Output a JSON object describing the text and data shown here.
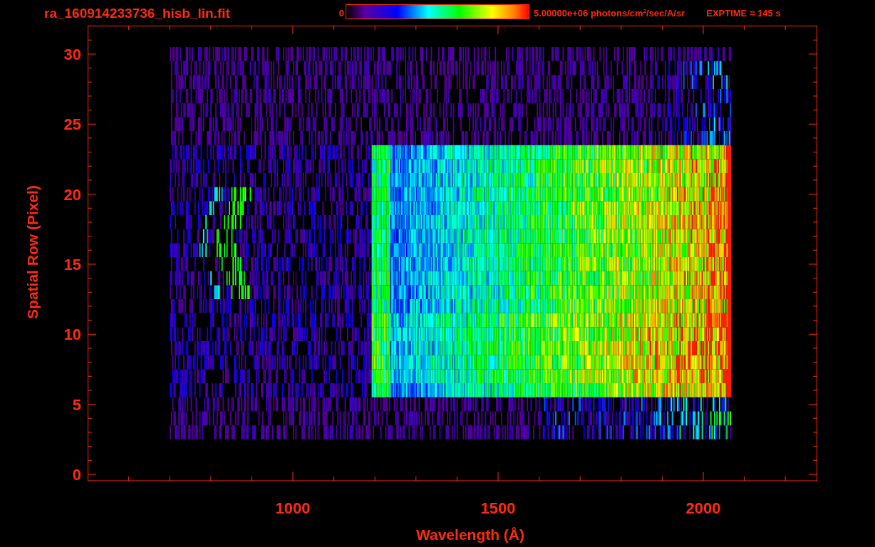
{
  "title": "ra_160914233736_hisb_lin.fit",
  "colorbar": {
    "min_label": "0",
    "max_label": "5.00000e+06 photons/cm$^{2}$/sec/A/sr"
  },
  "exposure": "EXPTIME = 145 s",
  "y_axis": {
    "label": "Spatial Row (Pixel)",
    "ticks": [
      "30",
      "25",
      "20",
      "15",
      "10",
      "5",
      "0"
    ]
  },
  "x_axis": {
    "label": "Wavelength (Å)",
    "ticks": [
      "1000",
      "1500",
      "2000"
    ]
  }
}
